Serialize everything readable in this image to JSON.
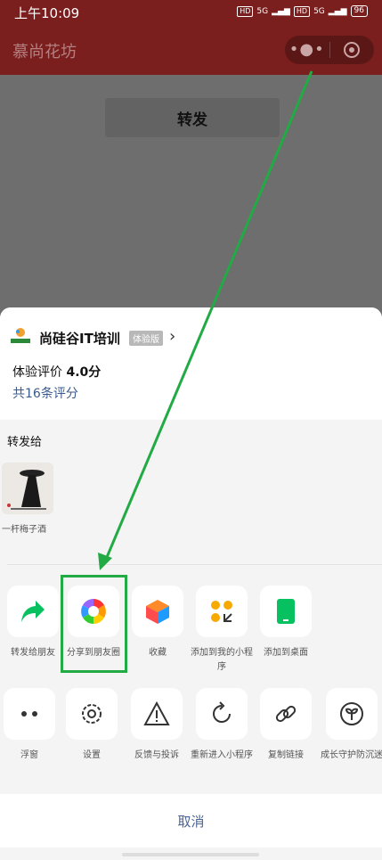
{
  "status_bar": {
    "time": "上午10:09",
    "network1": "5G",
    "network2": "5G",
    "battery": "96"
  },
  "title_bar": {
    "app_title": "慕尚花坊"
  },
  "page": {
    "forward_label": "转发"
  },
  "sheet": {
    "mini_program_name": "尚硅谷IT培训",
    "trial_badge": "体验版",
    "rating_label": "体验评价",
    "rating_value": "4.0分",
    "rating_count": "共16条评分",
    "share_to_label": "转发给",
    "contacts": [
      {
        "name": "一杆梅子酒"
      }
    ],
    "row1": [
      {
        "label": "转发给朋友",
        "icon": "share-arrow-icon"
      },
      {
        "label": "分享到朋友圈",
        "icon": "moments-aperture-icon"
      },
      {
        "label": "收藏",
        "icon": "favorite-cube-icon"
      },
      {
        "label": "添加到我的小程序",
        "icon": "add-mini-program-icon"
      },
      {
        "label": "添加到桌面",
        "icon": "add-to-desktop-icon"
      }
    ],
    "row2": [
      {
        "label": "浮窗",
        "icon": "float-window-icon"
      },
      {
        "label": "设置",
        "icon": "settings-gear-icon"
      },
      {
        "label": "反馈与投诉",
        "icon": "warning-triangle-icon"
      },
      {
        "label": "重新进入小程序",
        "icon": "reload-icon"
      },
      {
        "label": "复制链接",
        "icon": "link-icon"
      },
      {
        "label": "成长守护防沉迷",
        "icon": "sprout-icon"
      }
    ],
    "cancel_label": "取消"
  },
  "colors": {
    "brand_red": "#7a1e1e",
    "wechat_green": "#07c160",
    "annotation_green": "#22aa44",
    "link_blue": "#4a6496"
  }
}
